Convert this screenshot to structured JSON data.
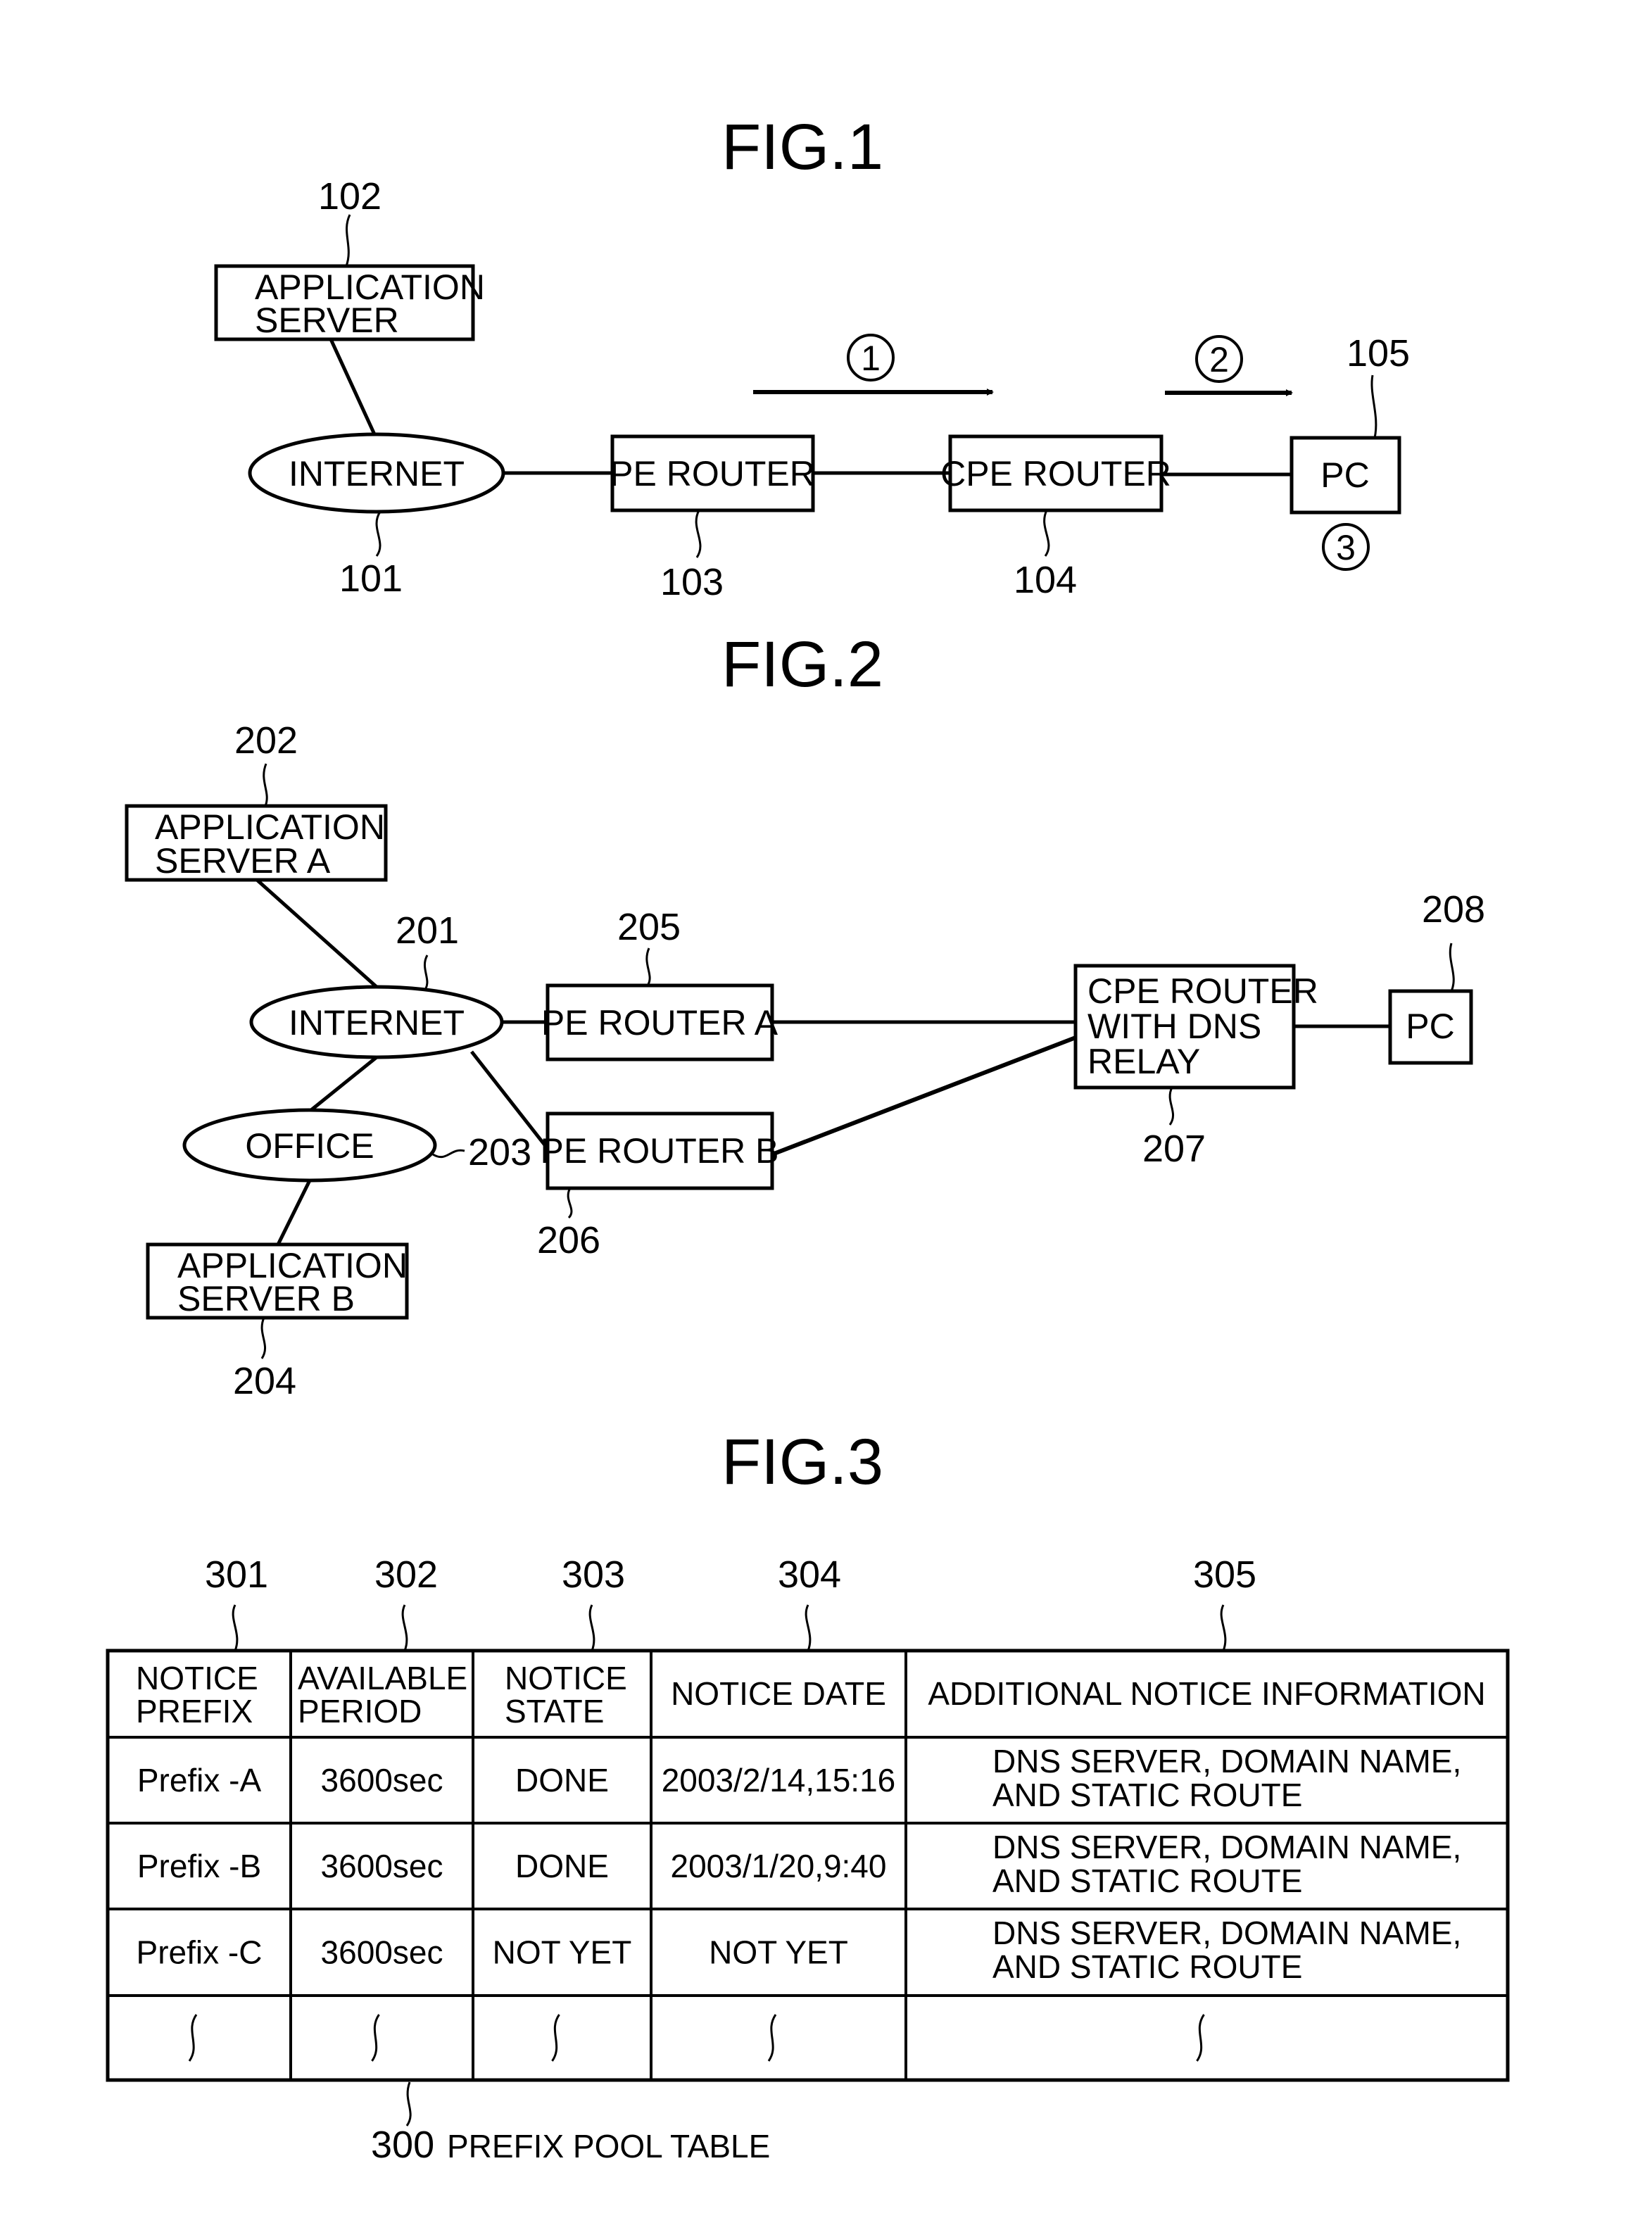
{
  "figures": {
    "fig1": {
      "title": "FIG.1",
      "nodes": {
        "app_server": {
          "lines": [
            "APPLICATION",
            "SERVER"
          ],
          "ref": "102"
        },
        "internet": {
          "label": "INTERNET",
          "ref": "101"
        },
        "pe_router": {
          "label": "PE ROUTER",
          "ref": "103"
        },
        "cpe_router": {
          "label": "CPE ROUTER",
          "ref": "104"
        },
        "pc": {
          "label": "PC",
          "ref": "105"
        }
      },
      "steps": [
        "1",
        "2",
        "3"
      ]
    },
    "fig2": {
      "title": "FIG.2",
      "nodes": {
        "app_server_a": {
          "lines": [
            "APPLICATION",
            "SERVER A"
          ],
          "ref": "202"
        },
        "internet": {
          "label": "INTERNET",
          "ref": "201"
        },
        "office": {
          "label": "OFFICE",
          "ref": "203"
        },
        "app_server_b": {
          "lines": [
            "APPLICATION",
            "SERVER B"
          ],
          "ref": "204"
        },
        "pe_router_a": {
          "label": "PE ROUTER A",
          "ref": "205"
        },
        "pe_router_b": {
          "label": "PE ROUTER B",
          "ref": "206"
        },
        "cpe_router_dns": {
          "lines": [
            "CPE ROUTER",
            "WITH DNS",
            "RELAY"
          ],
          "ref": "207"
        },
        "pc": {
          "label": "PC",
          "ref": "208"
        }
      }
    },
    "fig3": {
      "title": "FIG.3",
      "table": {
        "ref": "300",
        "caption": "PREFIX POOL TABLE",
        "columns": [
          {
            "ref": "301",
            "lines": [
              "NOTICE",
              "PREFIX"
            ]
          },
          {
            "ref": "302",
            "lines": [
              "AVAILABLE",
              "PERIOD"
            ]
          },
          {
            "ref": "303",
            "lines": [
              "NOTICE",
              "STATE"
            ]
          },
          {
            "ref": "304",
            "lines": [
              "NOTICE DATE"
            ]
          },
          {
            "ref": "305",
            "lines": [
              "ADDITIONAL NOTICE INFORMATION"
            ]
          }
        ],
        "rows": [
          {
            "prefix": "Prefix -A",
            "period": "3600sec",
            "state": "DONE",
            "date": "2003/2/14,15:16",
            "info": [
              "DNS SERVER, DOMAIN NAME,",
              "AND STATIC ROUTE"
            ]
          },
          {
            "prefix": "Prefix -B",
            "period": "3600sec",
            "state": "DONE",
            "date": "2003/1/20,9:40",
            "info": [
              "DNS SERVER, DOMAIN NAME,",
              "AND STATIC ROUTE"
            ]
          },
          {
            "prefix": "Prefix -C",
            "period": "3600sec",
            "state": "NOT YET",
            "date": "NOT YET",
            "info": [
              "DNS SERVER, DOMAIN NAME,",
              "AND STATIC ROUTE"
            ]
          }
        ],
        "continuation_row": true
      }
    }
  }
}
